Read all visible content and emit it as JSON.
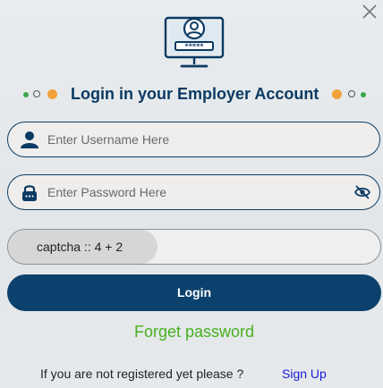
{
  "modal": {
    "title": "Login in your Employer Account",
    "close_icon": "close-icon",
    "logo_icon": "computer-login-icon"
  },
  "username": {
    "icon": "user-icon",
    "placeholder": "Enter Username Here",
    "value": ""
  },
  "password": {
    "icon": "lock-icon",
    "placeholder": "Enter Password Here",
    "value": "",
    "toggle_icon": "eye-slash-icon"
  },
  "captcha": {
    "label": "captcha :: 4 + 2",
    "value": ""
  },
  "login_button": "Login",
  "forgot_password": "Forget password",
  "register": {
    "prompt": "If you are not registered yet please ?",
    "link": "Sign Up"
  },
  "colors": {
    "primary": "#0b416c",
    "title": "#0b3a63",
    "accent_orange": "#f2a23a",
    "accent_green": "#3aa84a",
    "link_green": "#46b020",
    "link_blue": "#1a1ad8"
  }
}
